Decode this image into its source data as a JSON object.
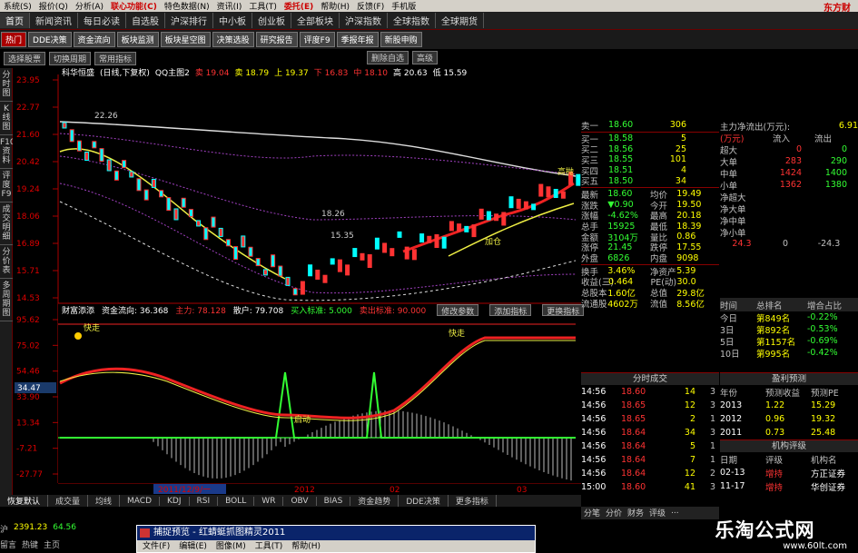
{
  "menubar": {
    "items": [
      "系统(S)",
      "报价(Q)",
      "分析(A)",
      "联心功能(C)",
      "特色数据(N)",
      "资讯(I)",
      "工具(T)",
      "委托(E)",
      "帮助(H)",
      "反馈(F)",
      "手机版"
    ],
    "brand": "东方财"
  },
  "navbar": {
    "tabs": [
      "首页",
      "新闻资讯",
      "每日必读",
      "自选股",
      "沪深排行",
      "中小板",
      "创业板",
      "全部板块",
      "沪深指数",
      "全球指数",
      "全球期货"
    ]
  },
  "subbar": {
    "tabs": [
      "热门",
      "DDE决策",
      "资金流向",
      "板块监测",
      "板块星空图",
      "决策选股",
      "研究报告",
      "评度F9",
      "季报年报",
      "新股申购"
    ]
  },
  "ctrl": {
    "left": [
      "选择股票",
      "切换周期",
      "常用指标"
    ],
    "right": [
      "删除自选",
      "高级"
    ]
  },
  "leftstrip": [
    "分时图",
    "K线图",
    "F10资料",
    "评度F9",
    "成交明细",
    "分价表",
    "多周期图"
  ],
  "mainhdr": {
    "name": "科华恒盛",
    "period": "(日线,下复权)",
    "indicator": "QQ主图2",
    "a": "卖 19.04",
    "b": "卖 18.79",
    "c": "上 19.37",
    "d": "下 16.83",
    "e": "中 18.10",
    "f": "高 20.63",
    "g": "低 15.59"
  },
  "yaxis_main": [
    "23.95",
    "22.77",
    "21.60",
    "20.42",
    "19.24",
    "18.06",
    "16.89",
    "15.71",
    "14.53"
  ],
  "annotations": {
    "hi": "22.26",
    "mid": "18.26",
    "r1": "15.35",
    "add": "加仓",
    "up": "高抛"
  },
  "indhdr": {
    "a": "财富添添",
    "b": "资金流向: 36.368",
    "c": "主力: 78.128",
    "d": "散户: 79.708",
    "e": "买入标准: 5.000",
    "f": "卖出标准: 90.000",
    "btns": [
      "修改参数",
      "添加指标",
      "更换指标"
    ]
  },
  "yaxis_ind": [
    "95.62",
    "75.02",
    "54.46",
    "33.90",
    "13.34",
    "-7.21",
    "-27.77"
  ],
  "ind_labels": {
    "fast": "快走",
    "cur": "34.47",
    "act": "启动"
  },
  "xaxis": {
    "a": "2011/12/9/一",
    "b": "2012",
    "c": "02",
    "d": "03"
  },
  "bottomtabs": [
    "恢复默认",
    "成交量",
    "均线",
    "MACD",
    "KDJ",
    "RSI",
    "BOLL",
    "WR",
    "OBV",
    "BIAS",
    "资金趋势",
    "DDE决策",
    "更多指标"
  ],
  "status": {
    "l1": "沪",
    "v1": "2391.23",
    "v2": "64.56",
    "tabs": [
      "留言",
      "热键",
      "主页"
    ]
  },
  "quote": {
    "sell": [
      {
        "l": "卖一",
        "p": "18.60",
        "v": "306"
      }
    ],
    "buy": [
      {
        "l": "买一",
        "p": "18.58",
        "v": "5"
      },
      {
        "l": "买二",
        "p": "18.56",
        "v": "25"
      },
      {
        "l": "买三",
        "p": "18.55",
        "v": "101"
      },
      {
        "l": "买四",
        "p": "18.51",
        "v": "4"
      },
      {
        "l": "买五",
        "p": "18.50",
        "v": "34"
      }
    ],
    "stats": [
      [
        "最新",
        "18.60",
        "均价",
        "19.49"
      ],
      [
        "涨跌",
        "▼0.90",
        "今开",
        "19.50"
      ],
      [
        "涨幅",
        "-4.62%",
        "最高",
        "20.18"
      ],
      [
        "总手",
        "15925",
        "最低",
        "18.39"
      ],
      [
        "金额",
        "3104万",
        "量比",
        "0.86"
      ],
      [
        "涨停",
        "21.45",
        "跌停",
        "17.55"
      ],
      [
        "外盘",
        "6826",
        "内盘",
        "9098"
      ]
    ],
    "stats2": [
      [
        "换手",
        "3.46%",
        "净资产",
        "5.39"
      ],
      [
        "收益(三)",
        "0.464",
        "PE(动)",
        "30.0"
      ],
      [
        "总股本",
        "1.60亿",
        "总值",
        "29.8亿"
      ],
      [
        "流通股",
        "4602万",
        "流值",
        "8.56亿"
      ]
    ]
  },
  "fundflow": {
    "title": "主力净流出(万元):",
    "val": "6.91",
    "unit": "(万元)",
    "inflow": "流入",
    "outflow": "流出",
    "rows": [
      [
        "超大",
        "0",
        "0"
      ],
      [
        "大单",
        "283",
        "290"
      ],
      [
        "中单",
        "1424",
        "1400"
      ],
      [
        "小单",
        "1362",
        "1380"
      ]
    ],
    "net": [
      "净超大",
      "净大单",
      "净中单",
      "净小单"
    ],
    "axis": [
      "24.3",
      "0",
      "-24.3"
    ]
  },
  "rank": {
    "h": [
      "时间",
      "总排名",
      "增合占比"
    ],
    "rows": [
      [
        "今日",
        "第849名",
        "-0.22%"
      ],
      [
        "3日",
        "第892名",
        "-0.53%"
      ],
      [
        "5日",
        "第1157名",
        "-0.69%"
      ],
      [
        "10日",
        "第995名",
        "-0.42%"
      ]
    ]
  },
  "trades": {
    "title": "分时成交",
    "rows": [
      [
        "14:56",
        "18.60",
        "14",
        "3"
      ],
      [
        "14:56",
        "18.65",
        "12",
        "3"
      ],
      [
        "14:56",
        "18.65",
        "2",
        "1"
      ],
      [
        "14:56",
        "18.64",
        "34",
        "3"
      ],
      [
        "14:56",
        "18.64",
        "5",
        "1"
      ],
      [
        "14:56",
        "18.64",
        "7",
        "1"
      ],
      [
        "14:56",
        "18.64",
        "12",
        "2"
      ],
      [
        "15:00",
        "18.60",
        "41",
        "3"
      ]
    ]
  },
  "forecast": {
    "title": "盈利预测",
    "h": [
      "年份",
      "预测收益",
      "预测PE"
    ],
    "rows": [
      [
        "2013",
        "1.22",
        "15.29"
      ],
      [
        "2012",
        "0.96",
        "19.32"
      ],
      [
        "2011",
        "0.73",
        "25.48"
      ]
    ],
    "org": "机构评级",
    "oh": [
      "日期",
      "评级",
      "机构名"
    ],
    "orows": [
      [
        "02-13",
        "增持",
        "方正证券"
      ],
      [
        "11-17",
        "增持",
        "华创证券"
      ]
    ]
  },
  "sidetabs": [
    "分笔",
    "分价",
    "财务",
    "评级",
    "..."
  ],
  "dialog": {
    "title": "捕捉预览 - 红蜻蜓抓图精灵2011",
    "menu": [
      "文件(F)",
      "编辑(E)",
      "图像(M)",
      "工具(T)",
      "帮助(H)"
    ]
  },
  "watermark": {
    "big": "乐淘公式网",
    "url": "www.60lt.com"
  }
}
